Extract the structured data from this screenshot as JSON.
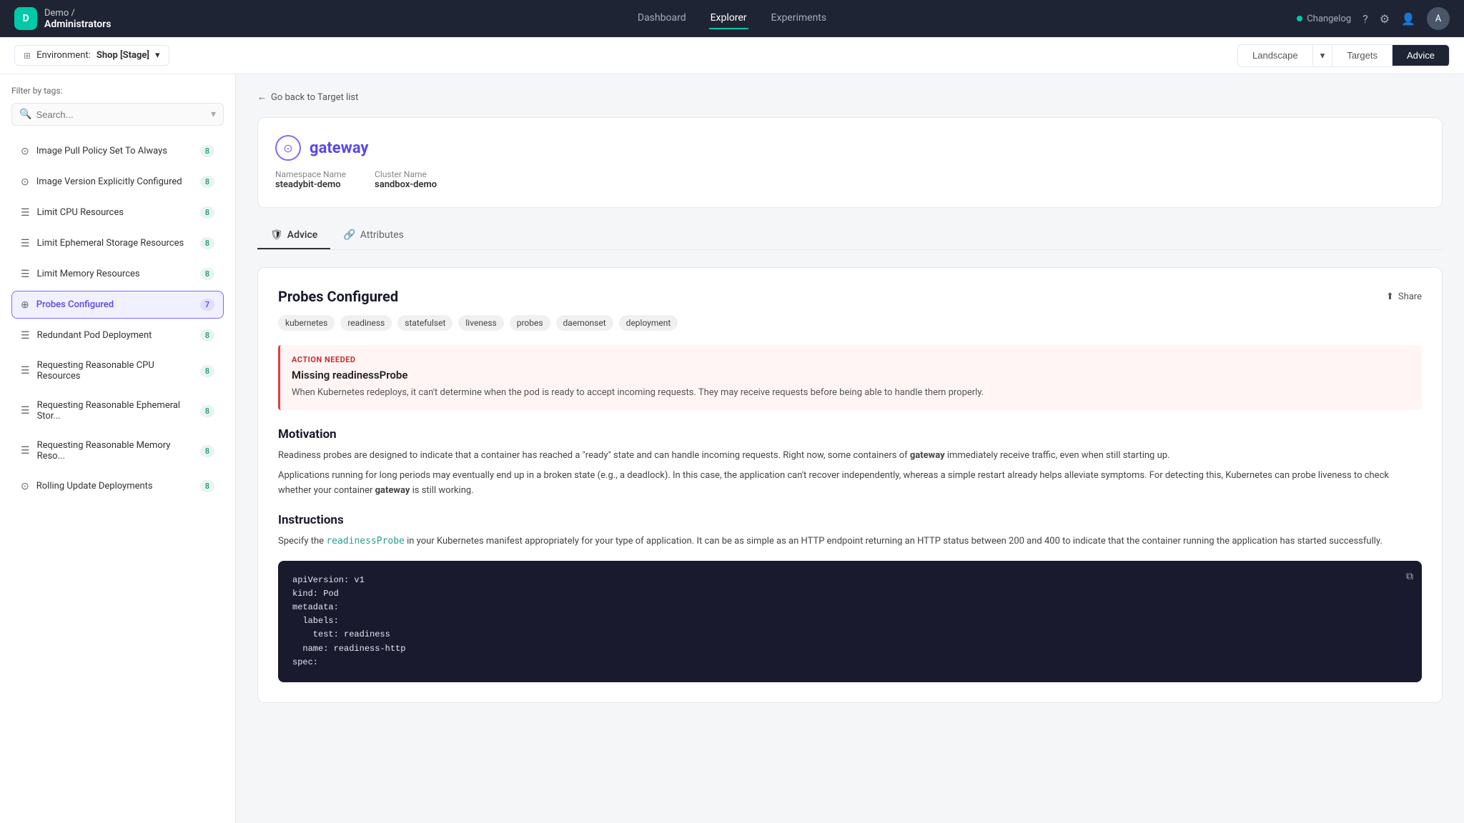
{
  "app": {
    "org": "Demo /",
    "orgSub": "Administrators",
    "logo": "D"
  },
  "nav": {
    "items": [
      {
        "label": "Dashboard",
        "active": false
      },
      {
        "label": "Explorer",
        "active": true
      },
      {
        "label": "Experiments",
        "active": false
      }
    ],
    "changelog": "Changelog",
    "avatar": "A"
  },
  "subNav": {
    "envLabel": "Environment:",
    "envName": "Shop [Stage]",
    "tabs": [
      {
        "label": "Landscape",
        "active": false
      },
      {
        "label": "▾",
        "dropdown": true
      },
      {
        "label": "Targets",
        "active": false
      },
      {
        "label": "Advice",
        "active": true
      }
    ]
  },
  "sidebar": {
    "filterLabel": "Filter by tags:",
    "searchPlaceholder": "Search...",
    "items": [
      {
        "label": "Image Pull Policy Set To Always",
        "badge": "8",
        "active": false,
        "icon": "⊙"
      },
      {
        "label": "Image Version Explicitly Configured",
        "badge": "8",
        "active": false,
        "icon": "⊙"
      },
      {
        "label": "Limit CPU Resources",
        "badge": "8",
        "active": false,
        "icon": "☰"
      },
      {
        "label": "Limit Ephemeral Storage Resources",
        "badge": "8",
        "active": false,
        "icon": "☰"
      },
      {
        "label": "Limit Memory Resources",
        "badge": "8",
        "active": false,
        "icon": "☰"
      },
      {
        "label": "Probes Configured",
        "badge": "7",
        "active": true,
        "icon": "⊕"
      },
      {
        "label": "Redundant Pod Deployment",
        "badge": "8",
        "active": false,
        "icon": "☰"
      },
      {
        "label": "Requesting Reasonable CPU Resources",
        "badge": "8",
        "active": false,
        "icon": "☰"
      },
      {
        "label": "Requesting Reasonable Ephemeral Stor...",
        "badge": "8",
        "active": false,
        "icon": "☰"
      },
      {
        "label": "Requesting Reasonable Memory Reso...",
        "badge": "8",
        "active": false,
        "icon": "☰"
      },
      {
        "label": "Rolling Update Deployments",
        "badge": "8",
        "active": false,
        "icon": "⊙"
      }
    ]
  },
  "content": {
    "backLink": "Go back to Target list",
    "target": {
      "name": "gateway",
      "namespaceLabel": "Namespace Name",
      "namespace": "steadybit-demo",
      "clusterLabel": "Cluster Name",
      "cluster": "sandbox-demo"
    },
    "tabs": [
      {
        "label": "Advice",
        "active": true,
        "icon": "🛡"
      },
      {
        "label": "Attributes",
        "active": false,
        "icon": "🔗"
      }
    ],
    "advice": {
      "title": "Probes Configured",
      "shareLabel": "Share",
      "tags": [
        "kubernetes",
        "readiness",
        "statefulset",
        "liveness",
        "probes",
        "daemonset",
        "deployment"
      ],
      "actionNeeded": {
        "label": "ACTION NEEDED",
        "title": "Missing readinessProbe",
        "description": "When Kubernetes redeploys, it can't determine when the pod is ready to accept incoming requests. They may receive requests before being able to handle them properly."
      },
      "motivation": {
        "title": "Motivation",
        "paragraphs": [
          "Readiness probes are designed to indicate that a container has reached a \"ready\" state and can handle incoming requests. Right now, some containers of  gateway  immediately receive traffic, even when still starting up.",
          "Applications running for long periods may eventually end up in a broken state (e.g., a deadlock). In this case, the application can't recover independently, whereas a simple restart already helps alleviate symptoms. For detecting this, Kubernetes can probe liveness to check whether your container  gateway  is still working."
        ]
      },
      "instructions": {
        "title": "Instructions",
        "text": "Specify the  readinessProbe  in your Kubernetes manifest appropriately for your type of application. It can be as simple as an HTTP endpoint returning an HTTP status between 200 and 400 to indicate that the container running the application has started successfully.",
        "code": [
          "apiVersion: v1",
          "kind: Pod",
          "metadata:",
          "  labels:",
          "    test: readiness",
          "  name: readiness-http",
          "spec:"
        ]
      }
    }
  }
}
